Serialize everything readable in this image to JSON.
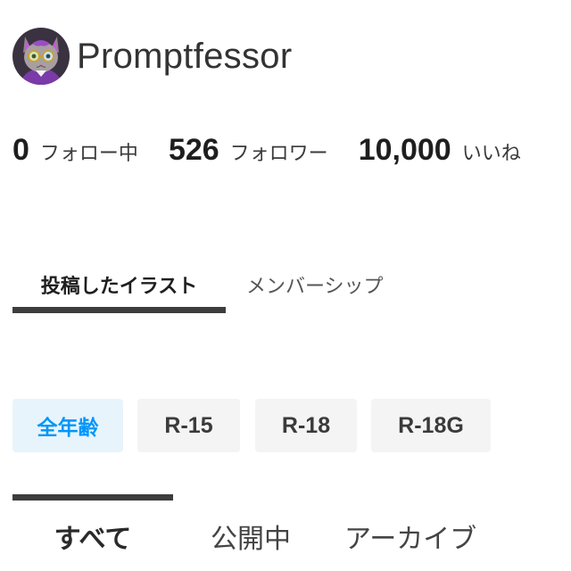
{
  "profile": {
    "avatar_icon": "cat-avatar-icon",
    "username": "Promptfessor"
  },
  "stats": {
    "following": {
      "value": "0",
      "label": "フォロー中"
    },
    "followers": {
      "value": "526",
      "label": "フォロワー"
    },
    "likes": {
      "value": "10,000",
      "label": "いいね"
    }
  },
  "main_tabs": [
    {
      "label": "投稿したイラスト",
      "active": true
    },
    {
      "label": "メンバーシップ",
      "active": false
    }
  ],
  "rating_filters": [
    {
      "label": "全年齢",
      "selected": true
    },
    {
      "label": "R-15",
      "selected": false
    },
    {
      "label": "R-18",
      "selected": false
    },
    {
      "label": "R-18G",
      "selected": false
    }
  ],
  "sub_tabs": [
    {
      "label": "すべて",
      "active": true
    },
    {
      "label": "公開中",
      "active": false
    },
    {
      "label": "アーカイブ",
      "active": false
    }
  ],
  "colors": {
    "accent": "#0096fa",
    "selected_chip_bg": "#e8f4fc",
    "chip_bg": "#f4f4f4",
    "indicator": "#3d3d3d"
  }
}
